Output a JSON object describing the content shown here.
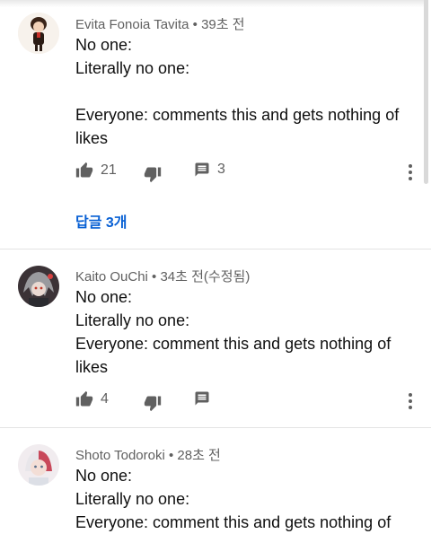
{
  "comments": [
    {
      "author": "Evita Fonoia Tavita",
      "time": "39초 전",
      "lines": [
        "No one:",
        "Literally no one:",
        "",
        "Everyone: comments this and gets nothing of",
        "likes"
      ],
      "likes": "21",
      "reply_count": "3",
      "replies_link": "답글 3개",
      "avatar_icon": "chibi-character-avatar"
    },
    {
      "author": "Kaito OuChi",
      "time": "34초 전(수정됨)",
      "lines": [
        "No one:",
        "Literally no one:",
        "Everyone: comment this and gets nothing of",
        "likes"
      ],
      "likes": "4",
      "avatar_icon": "grey-haired-character-avatar"
    },
    {
      "author": "Shoto Todoroki",
      "time": "28초 전",
      "lines": [
        "No one:",
        "Literally no one:",
        "Everyone: comment this and gets nothing of"
      ],
      "avatar_icon": "anime-character-avatar"
    }
  ],
  "separator": " • ",
  "colors": {
    "meta": "#606060",
    "link": "#065fd4",
    "text": "#0f0f0f"
  }
}
